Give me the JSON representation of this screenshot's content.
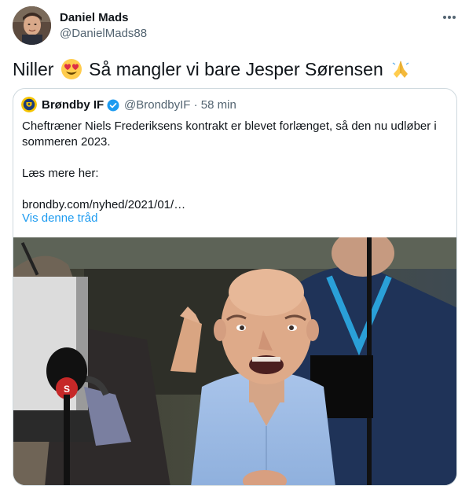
{
  "author": {
    "name": "Daniel Mads",
    "handle": "@DanielMads88"
  },
  "tweet": {
    "text_part1": "Niller",
    "text_part2": "Så mangler vi bare Jesper Sørensen",
    "emoji1": "heart-eyes-emoji",
    "emoji2": "folded-hands-emoji"
  },
  "quoted_tweet": {
    "name": "Brøndby IF",
    "handle": "@BrondbyIF",
    "separator": "·",
    "time": "58 min",
    "line1": "Cheftræner Niels Frederiksens kontrakt er blevet forlænget, så den nu udløber i sommeren 2023.",
    "line2": "Læs mere her:",
    "link": "brondby.com/nyhed/2021/01/…",
    "show_thread": "Vis denne tråd",
    "camera_logo_text": "S"
  },
  "colors": {
    "accent": "#1d9bf0",
    "secondary_text": "#536471",
    "border": "#cfd9de",
    "brondby_yellow": "#f5c400",
    "brondby_blue": "#1d3c7a"
  }
}
